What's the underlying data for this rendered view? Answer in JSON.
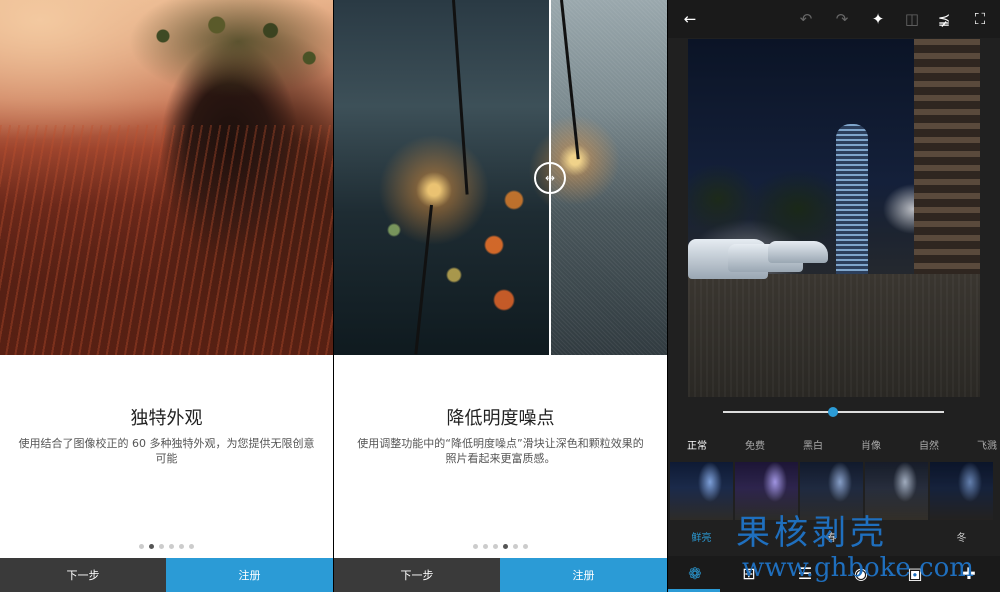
{
  "screens": [
    {
      "title": "独特外观",
      "description": "使用结合了图像校正的 60 多种独特外观，为您提供无限创意可能",
      "dots_total": 6,
      "dot_active": 2,
      "next_label": "下一步",
      "register_label": "注册"
    },
    {
      "title": "降低明度噪点",
      "description": "使用调整功能中的“降低明度噪点”滑块让深色和颗粒效果的照片看起来更富质感。",
      "dots_total": 6,
      "dot_active": 4,
      "next_label": "下一步",
      "register_label": "注册"
    }
  ],
  "editor": {
    "top_icons": [
      "back-arrow-icon",
      "undo-icon",
      "redo-icon",
      "magic-wand-icon",
      "compare-icon",
      "share-icon",
      "fullscreen-icon"
    ],
    "slider_value": 0.5,
    "categories": [
      "正常",
      "免费",
      "黑白",
      "肖像",
      "自然",
      "飞溅"
    ],
    "active_category": "正常",
    "thumbnails": [
      "鲜亮",
      "",
      "春",
      "",
      "冬"
    ],
    "active_thumbnail": "鲜亮",
    "bottom_icons": [
      "looks-icon",
      "crop-icon",
      "adjust-icon",
      "redeye-icon",
      "frame-icon",
      "heal-icon"
    ],
    "accent_color": "#2b9bd6"
  },
  "watermark": {
    "line1": "果核剥壳",
    "line2": "www.ghboke.com"
  }
}
